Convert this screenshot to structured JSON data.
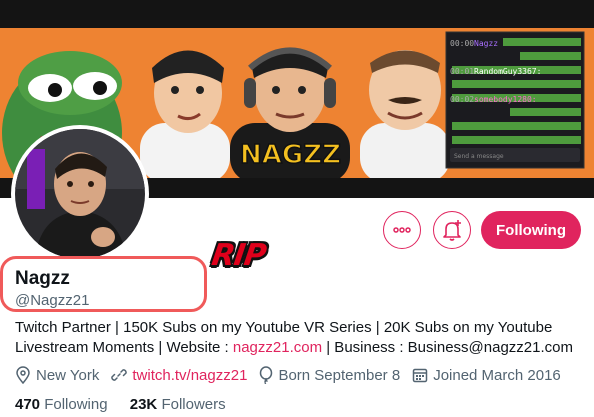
{
  "banner": {
    "brand_text": "NAGZZ",
    "chat_lines": [
      {
        "time": "00:00",
        "user": "Nagzz",
        "color": "#a970ff"
      },
      {
        "time": "00:01",
        "user": "RandomGuy3367:",
        "color": "#ffffff"
      },
      {
        "time": "00:02",
        "user": "somebody1280:",
        "color": "#ff6bd1"
      }
    ],
    "chat_placeholder": "Send a message"
  },
  "overlay": {
    "rip_text": "RIP"
  },
  "actions": {
    "more_icon": "more-dots-icon",
    "bell_icon": "bell-plus-icon",
    "following_label": "Following"
  },
  "profile": {
    "display_name": "Nagzz",
    "handle": "@Nagzz21",
    "bio_line1": "Twitch Partner | 150K Subs on my Youtube VR Series | 20K Subs on my Youtube",
    "bio_line2_prefix": "Livestream Moments | Website : ",
    "bio_website": "nagzz21.com",
    "bio_line2_suffix": " | Business : Business@nagzz21.com",
    "location": "New York",
    "url": "twitch.tv/nagzz21",
    "birthday": "Born September 8",
    "joined": "Joined March 2016",
    "following_count": "470",
    "following_label": "Following",
    "followers_count": "23K",
    "followers_label": "Followers"
  },
  "colors": {
    "accent": "#e0245e",
    "muted": "#536471",
    "highlight_ring": "#f05a5a",
    "rip": "#e0001b"
  }
}
